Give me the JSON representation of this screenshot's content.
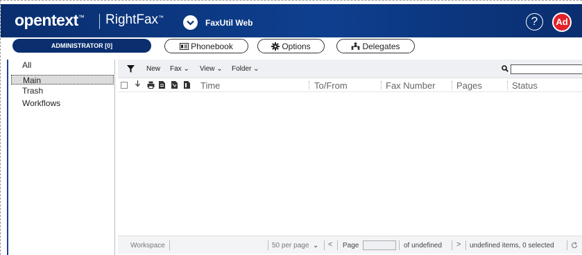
{
  "header": {
    "brand": "opentext",
    "brand_tm": "™",
    "product": "RightFax",
    "product_tm": "™",
    "app_name": "FaxUtil Web",
    "help_label": "?",
    "avatar_initials": "Ad",
    "colors": {
      "header_bg": "#0a2e6e",
      "avatar_bg": "#e3212b"
    }
  },
  "toolbar": {
    "admin_label": "ADMINISTRATOR [0]",
    "phonebook_label": "Phonebook",
    "options_label": "Options",
    "delegates_label": "Delegates"
  },
  "sidebar": {
    "items": [
      {
        "label": "All",
        "selected": false
      },
      {
        "label": "Main",
        "selected": true
      },
      {
        "label": "Trash",
        "selected": false
      },
      {
        "label": "Workflows",
        "selected": false
      }
    ]
  },
  "actions": {
    "new_label": "New",
    "fax_label": "Fax",
    "view_label": "View",
    "folder_label": "Folder",
    "search_placeholder": ""
  },
  "table": {
    "columns": [
      "Time",
      "To/From",
      "Fax Number",
      "Pages",
      "Status"
    ],
    "icons": [
      "filter-icon",
      "checkbox-icon",
      "sort-icon",
      "printer-icon",
      "document-icon",
      "document-pdf-icon",
      "document-attach-icon"
    ],
    "rows": []
  },
  "footer": {
    "workspace_label": "Workspace",
    "per_page": "50 per page",
    "page_label": "Page",
    "page_value": "",
    "of_label": "of undefined",
    "status": "undefined items, 0 selected"
  }
}
